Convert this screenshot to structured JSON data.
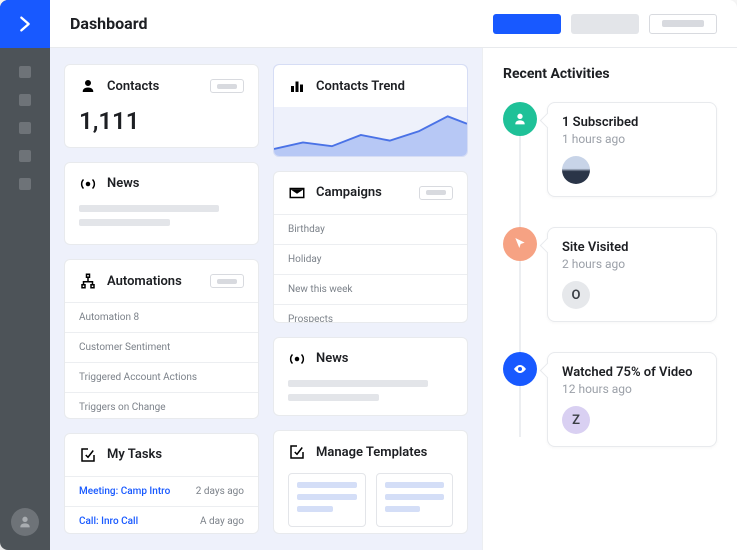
{
  "header": {
    "title": "Dashboard"
  },
  "contacts": {
    "title": "Contacts",
    "value": "1,111"
  },
  "trend": {
    "title": "Contacts Trend"
  },
  "news": {
    "title": "News"
  },
  "news2": {
    "title": "News"
  },
  "campaigns": {
    "title": "Campaigns",
    "items": [
      "Birthday",
      "Holiday",
      "New this week",
      "Prospects"
    ]
  },
  "automations": {
    "title": "Automations",
    "items": [
      "Automation 8",
      "Customer Sentiment",
      "Triggered Account Actions",
      "Triggers on Change"
    ]
  },
  "tasks": {
    "title": "My Tasks",
    "items": [
      {
        "label": "Meeting: Camp Intro",
        "time": "2 days ago"
      },
      {
        "label": "Call: Inro Call",
        "time": "A day ago"
      }
    ]
  },
  "templates": {
    "title": "Manage Templates"
  },
  "activities": {
    "title": "Recent Activities",
    "items": [
      {
        "title": "1 Subscribed",
        "time": "1 hours ago",
        "avatar_letter": ""
      },
      {
        "title": "Site Visited",
        "time": "2 hours ago",
        "avatar_letter": "O"
      },
      {
        "title": "Watched 75% of Video",
        "time": "12 hours ago",
        "avatar_letter": "Z"
      }
    ]
  }
}
